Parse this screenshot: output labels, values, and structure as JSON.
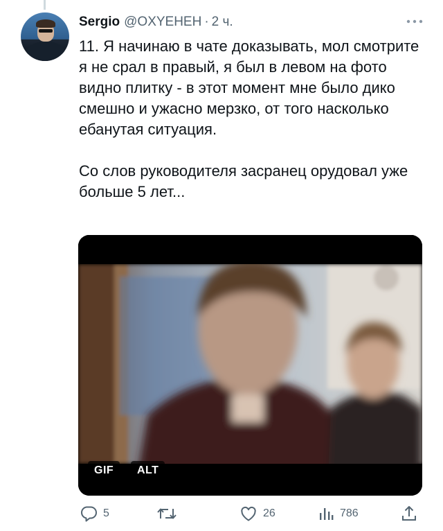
{
  "author": {
    "name": "Sergio",
    "handle": "@OXYEHEH",
    "separator": "·",
    "time": "2 ч."
  },
  "tweet": {
    "text": "11. Я начинаю в чате доказывать, мол смотрите я не срал в правый, я был в левом на фото видно плитку - в этот момент мне было дико смешно и ужасно мерзко, от того насколько ебанутая ситуация.\n\nСо слов руководителя засранец орудовал уже больше 5 лет..."
  },
  "media": {
    "type_badge": "GIF",
    "alt_badge": "ALT"
  },
  "actions": {
    "replies": "5",
    "reposts": "",
    "likes": "26",
    "views": "786"
  },
  "icons": {
    "more": "more-horizontal-icon",
    "reply": "reply-bubble-icon",
    "repost": "repost-arrows-icon",
    "like": "heart-icon",
    "views": "bar-chart-icon",
    "share": "share-upload-icon"
  },
  "colors": {
    "text_primary": "#0f1419",
    "text_secondary": "#536471",
    "divider": "#cfd9de"
  }
}
